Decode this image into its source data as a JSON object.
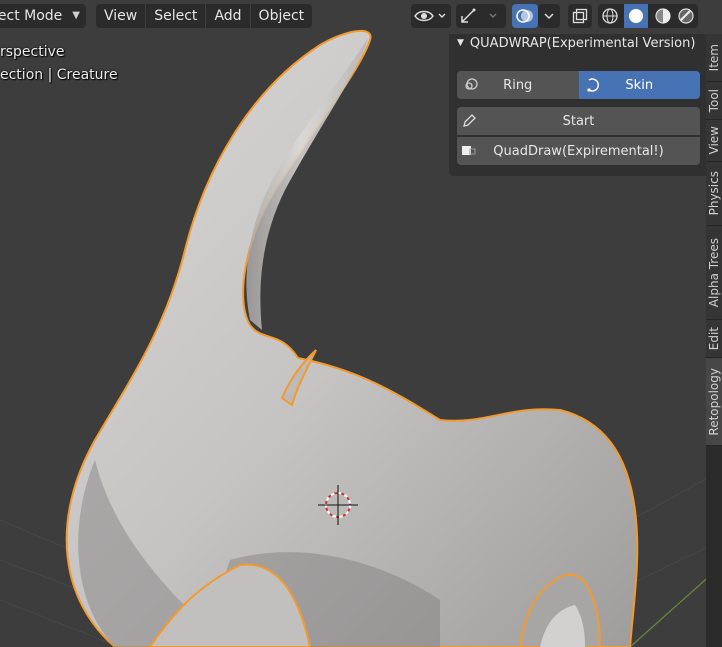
{
  "header": {
    "mode_label": "ject Mode",
    "menu": [
      "View",
      "Select",
      "Add",
      "Object"
    ]
  },
  "overlay": {
    "view_line": "rspective",
    "collection_line": "ection | Creature"
  },
  "panel": {
    "title": "QUADWRAP(Experimental Version)",
    "ring_label": "Ring",
    "skin_label": "Skin",
    "start_label": "Start",
    "quaddraw_label": "QuadDraw(Expiremental!)"
  },
  "tabs": [
    "Item",
    "Tool",
    "View",
    "Physics",
    "Alpha Trees",
    "Edit",
    "Retopology"
  ],
  "colors": {
    "viewport_bg": "#3d3d3d",
    "selection_outline": "#f29a2e",
    "active_blue": "#4772b3",
    "mesh": "#c8c6c5"
  },
  "icons": {
    "visibility": "eye-icon",
    "gizmo": "gizmo-icon",
    "overlays": "overlay-icon",
    "xray": "xray-icon",
    "shading": [
      "wireframe-icon",
      "solid-icon",
      "material-icon",
      "rendered-icon"
    ],
    "cursor": "3d-cursor-icon"
  }
}
